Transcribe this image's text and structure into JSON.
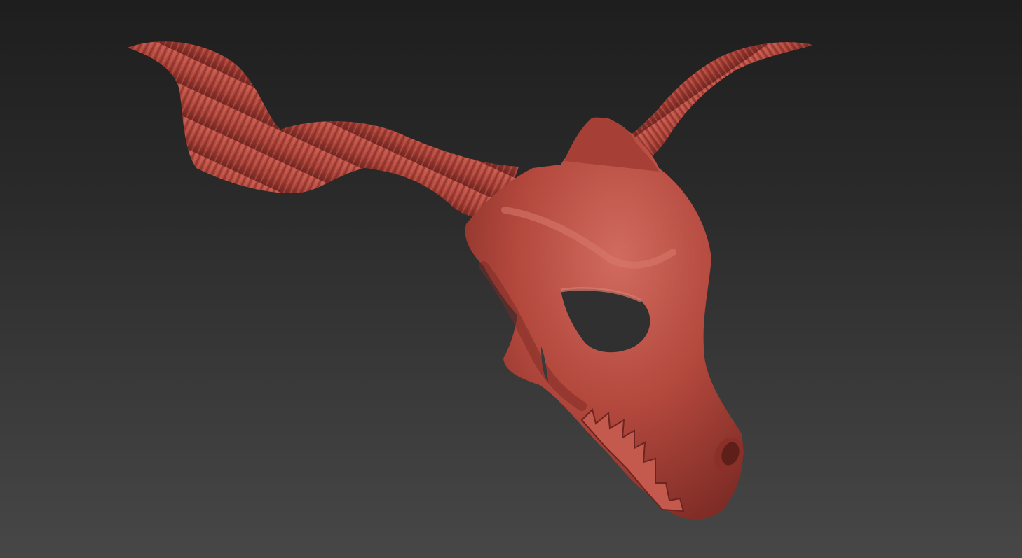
{
  "viewport": {
    "background_top": "#1e1e1e",
    "background_bottom": "#474747"
  },
  "model": {
    "subject": "horned-skull-sculpt",
    "material_color": "#b3483d",
    "highlight_color": "#d06a5e",
    "shadow_color": "#6e241f"
  }
}
